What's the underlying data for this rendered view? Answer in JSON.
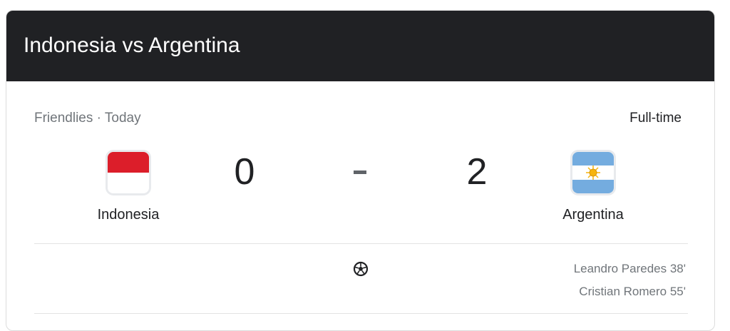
{
  "header": {
    "title": "Indonesia vs Argentina"
  },
  "match": {
    "competition_line": "Friendlies · Today",
    "status": "Full-time",
    "separator": "-",
    "home": {
      "name": "Indonesia",
      "score": "0",
      "flag_icon": "indonesia-flag-icon",
      "flag_colors": [
        "#dc1e2a",
        "#ffffff"
      ]
    },
    "away": {
      "name": "Argentina",
      "score": "2",
      "flag_icon": "argentina-flag-icon",
      "flag_colors": [
        "#74acdf",
        "#ffffff",
        "#f6b40e"
      ]
    }
  },
  "goals": {
    "icon": "soccer-ball-icon",
    "away_scorers": [
      "Leandro Paredes 38'",
      "Cristian Romero 55'"
    ]
  },
  "colors": {
    "header_bg": "#202124",
    "header_text": "#ffffff",
    "primary_text": "#202124",
    "secondary_text": "#70757a"
  }
}
